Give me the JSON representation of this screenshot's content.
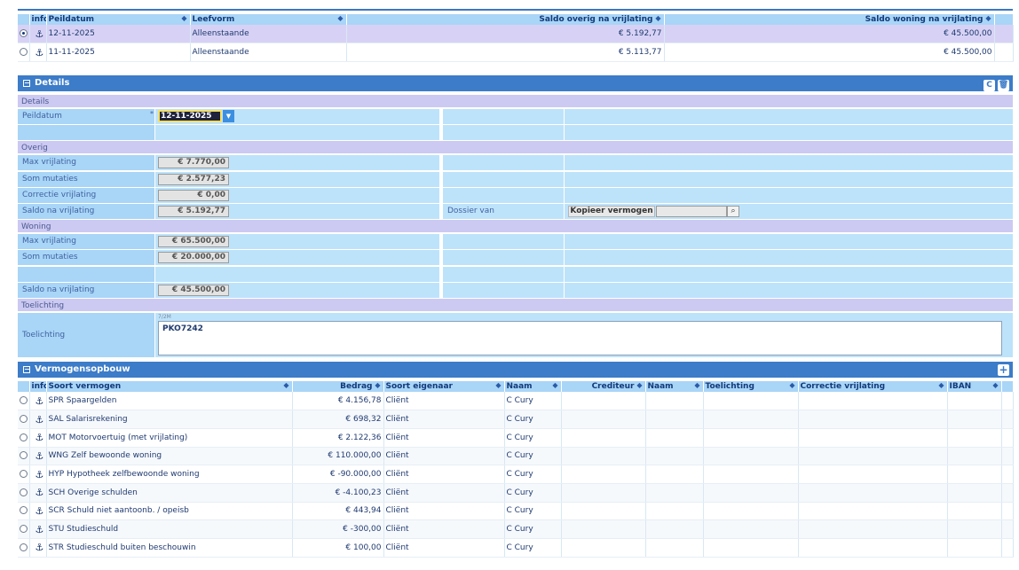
{
  "top_grid": {
    "columns": [
      "info",
      "Peildatum",
      "Leefvorm",
      "Saldo overig na vrijlating",
      "Saldo woning na vrijlating"
    ],
    "rows": [
      {
        "selected": true,
        "peildatum": "12-11-2025",
        "leefvorm": "Alleenstaande",
        "saldo_overig": "€ 5.192,77",
        "saldo_woning": "€ 45.500,00"
      },
      {
        "selected": false,
        "peildatum": "11-11-2025",
        "leefvorm": "Alleenstaande",
        "saldo_overig": "€ 5.113,77",
        "saldo_woning": "€ 45.500,00"
      }
    ]
  },
  "details": {
    "title": "Details",
    "group_details": "Details",
    "peildatum_label": "Peildatum",
    "peildatum_value": "12-11-2025",
    "group_overig": "Overig",
    "overig": [
      {
        "label": "Max vrijlating",
        "value": "€ 7.770,00"
      },
      {
        "label": "Som mutaties",
        "value": "€ 2.577,23"
      },
      {
        "label": "Correctie vrijlating",
        "value": "€ 0,00"
      },
      {
        "label": "Saldo na vrijlating",
        "value": "€ 5.192,77"
      }
    ],
    "dossier_label": "Dossier van",
    "kopieer_label": "Kopieer vermogen",
    "group_woning": "Woning",
    "woning": [
      {
        "label": "Max vrijlating",
        "value": "€ 65.500,00"
      },
      {
        "label": "Som mutaties",
        "value": "€ 20.000,00"
      },
      {
        "label": "",
        "value": ""
      },
      {
        "label": "Saldo na vrijlating",
        "value": "€ 45.500,00"
      }
    ],
    "group_toelichting": "Toelichting",
    "toelichting_label": "Toelichting",
    "toelichting_count": "7/2M",
    "toelichting_value": "PKO7242"
  },
  "vermogensopbouw": {
    "title": "Vermogensopbouw",
    "columns": [
      "info",
      "Soort vermogen",
      "Bedrag",
      "Soort eigenaar",
      "Naam",
      "Crediteur",
      "Naam",
      "Toelichting",
      "Correctie vrijlating",
      "IBAN"
    ],
    "rows": [
      {
        "soort": "SPR Spaargelden",
        "bedrag": "€ 4.156,78",
        "eigenaar": "Cliënt",
        "naam": "C Cury"
      },
      {
        "soort": "SAL Salarisrekening",
        "bedrag": "€ 698,32",
        "eigenaar": "Cliënt",
        "naam": "C Cury"
      },
      {
        "soort": "MOT Motorvoertuig (met vrijlating)",
        "bedrag": "€ 2.122,36",
        "eigenaar": "Cliënt",
        "naam": "C Cury"
      },
      {
        "soort": "WNG Zelf bewoonde woning",
        "bedrag": "€ 110.000,00",
        "eigenaar": "Cliënt",
        "naam": "C Cury"
      },
      {
        "soort": "HYP Hypotheek zelfbewoonde woning",
        "bedrag": "€ -90.000,00",
        "eigenaar": "Cliënt",
        "naam": "C Cury"
      },
      {
        "soort": "SCH Overige schulden",
        "bedrag": "€ -4.100,23",
        "eigenaar": "Cliënt",
        "naam": "C Cury"
      },
      {
        "soort": "SCR Schuld niet aantoonb. / opeisb",
        "bedrag": "€ 443,94",
        "eigenaar": "Cliënt",
        "naam": "C Cury"
      },
      {
        "soort": "STU Studieschuld",
        "bedrag": "€ -300,00",
        "eigenaar": "Cliënt",
        "naam": "C Cury"
      },
      {
        "soort": "STR Studieschuld buiten beschouwin",
        "bedrag": "€ 100,00",
        "eigenaar": "Cliënt",
        "naam": "C Cury"
      }
    ]
  }
}
